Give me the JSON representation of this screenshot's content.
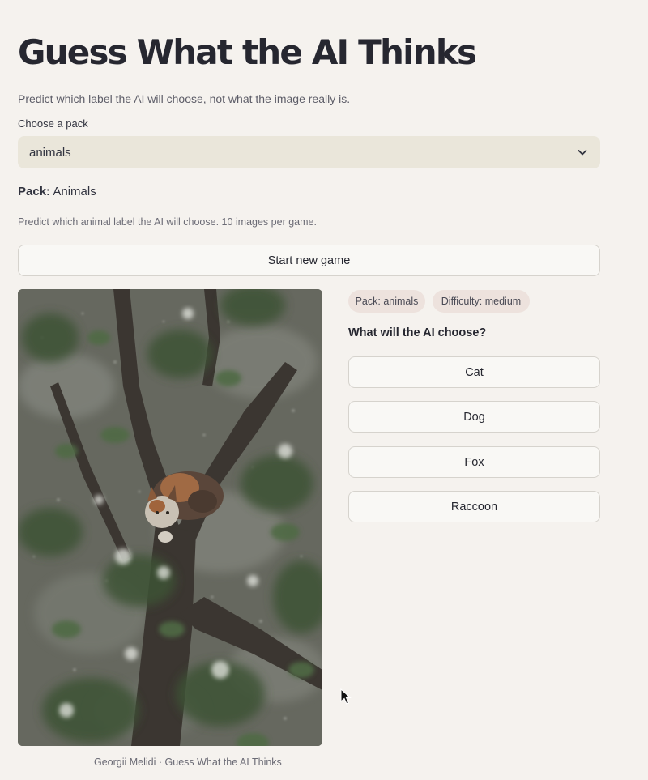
{
  "header": {
    "title": "Guess What the AI Thinks",
    "subtitle": "Predict which label the AI will choose, not what the image really is."
  },
  "pack_select": {
    "label": "Choose a pack",
    "value": "animals"
  },
  "pack_info": {
    "label": "Pack:",
    "name": "Animals",
    "description": "Predict which animal label the AI will choose. 10 images per game."
  },
  "start_button": {
    "label": "Start new game"
  },
  "tags": {
    "pack": "Pack: animals",
    "difficulty": "Difficulty: medium"
  },
  "question": "What will the AI choose?",
  "options": [
    "Cat",
    "Dog",
    "Fox",
    "Raccoon"
  ],
  "footer": {
    "text": "Georgii Melidi · Guess What the AI Thinks"
  },
  "icons": {
    "select": "chevron-down-icon",
    "pointer": "mouse-cursor-icon"
  },
  "colors": {
    "background": "#f5f2ee",
    "select_bg": "#eae6da",
    "tag_bg": "#ede2dd",
    "button_bg": "#f9f8f5"
  }
}
